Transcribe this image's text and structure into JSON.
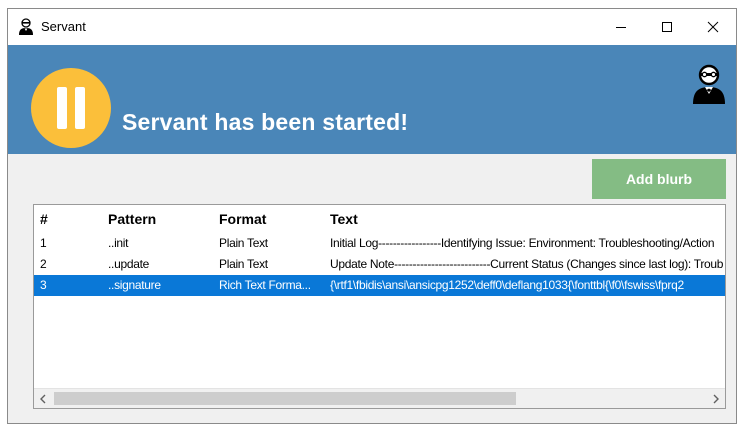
{
  "window": {
    "title": "Servant",
    "title_icon": "servant-icon",
    "controls": {
      "minimize": "minimize-icon",
      "maximize": "maximize-icon",
      "close": "close-icon"
    }
  },
  "banner": {
    "status_text": "Servant has been started!",
    "status_icon": "pause-icon",
    "status_color": "#fbbf3a",
    "background": "#4a86b8",
    "logo_icon": "butler-icon"
  },
  "toolbar": {
    "add_blurb_label": "Add blurb",
    "add_blurb_color": "#84bc84"
  },
  "list": {
    "columns": [
      "#",
      "Pattern",
      "Format",
      "Text"
    ],
    "rows": [
      {
        "num": "1",
        "pattern": "..init",
        "format": "Plain Text",
        "text": "Initial Log-----------------Identifying Issue: Environment: Troubleshooting/Action"
      },
      {
        "num": "2",
        "pattern": "..update",
        "format": "Plain Text",
        "text": "Update Note--------------------------Current Status (Changes since last log): Troub"
      },
      {
        "num": "3",
        "pattern": "..signature",
        "format": "Rich Text Forma...",
        "text": "{\\rtf1\\fbidis\\ansi\\ansicpg1252\\deff0\\deflang1033{\\fonttbl{\\f0\\fswiss\\fprq2"
      }
    ],
    "selected_row": 3,
    "selection_color": "#0a78d7"
  },
  "scrollbar": {
    "left_arrow": "scroll-left-icon",
    "right_arrow": "scroll-right-icon"
  }
}
